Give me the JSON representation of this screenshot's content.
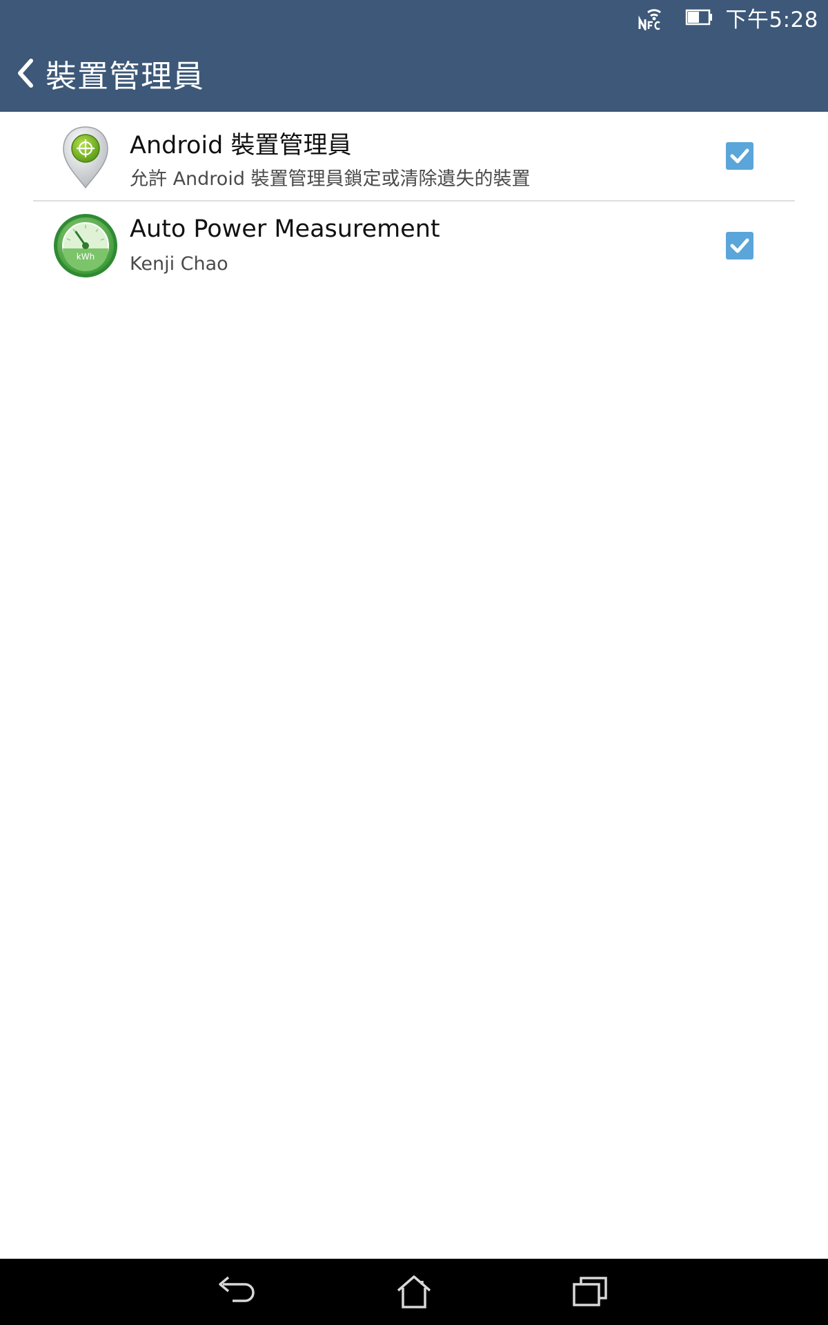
{
  "status_bar": {
    "time": "下午5:28",
    "icons": [
      "nfc-icon",
      "battery-icon"
    ]
  },
  "action_bar": {
    "back_icon": "chevron-left-icon",
    "title": "裝置管理員"
  },
  "list": [
    {
      "icon": "android-device-manager-icon",
      "title": "Android 裝置管理員",
      "subtitle": "允許 Android 裝置管理員鎖定或清除遺失的裝置",
      "checked": true
    },
    {
      "icon": "power-meter-icon",
      "title": "Auto Power Measurement",
      "subtitle": "Kenji Chao",
      "checked": true
    }
  ],
  "nav_bar": {
    "buttons": [
      "back-icon",
      "home-icon",
      "recent-apps-icon"
    ]
  },
  "colors": {
    "header": "#3d5878",
    "checkbox": "#5aa5d9",
    "nav_bar": "#000000"
  }
}
